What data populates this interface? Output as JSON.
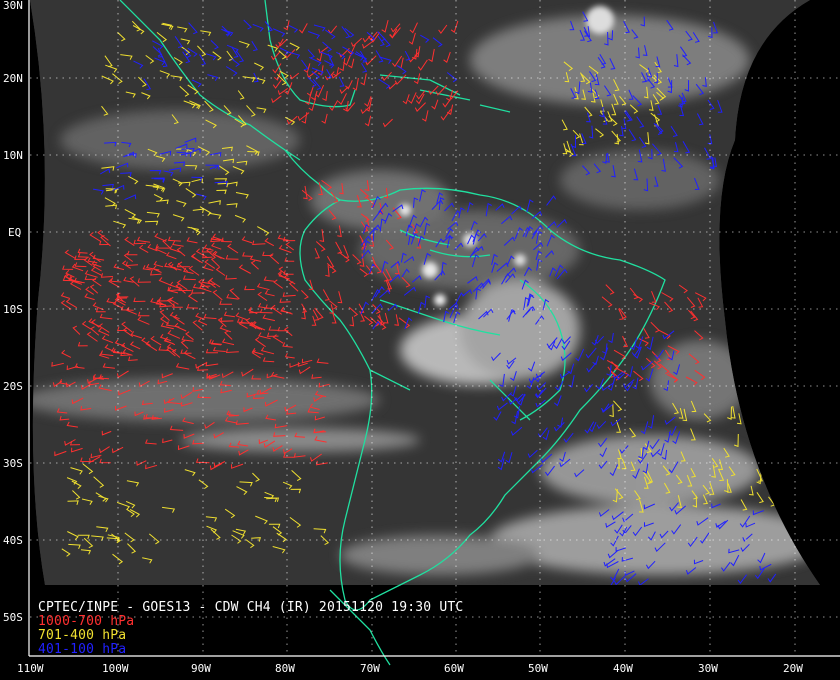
{
  "caption": {
    "title": "CPTEC/INPE - GOES13 - CDW CH4 (IR) 20151120 19:30 UTC",
    "legend": [
      {
        "label": "1000-700 hPa",
        "color": "#ff3030"
      },
      {
        "label": "701-400 hPa",
        "color": "#f0e030"
      },
      {
        "label": "401-100 hPa",
        "color": "#2020ff"
      }
    ]
  },
  "lat_labels": [
    "30N",
    "20N",
    "10N",
    "EQ",
    "10S",
    "20S",
    "30S",
    "40S",
    "50S"
  ],
  "lon_labels": [
    "110W",
    "100W",
    "90W",
    "80W",
    "70W",
    "60W",
    "50W",
    "40W",
    "30W",
    "20W"
  ],
  "colors": {
    "background": "#000000",
    "coastline": "#20e0a0",
    "grid": "#ffffff",
    "low_level_vectors": "#ff3030",
    "mid_level_vectors": "#f0e030",
    "high_level_vectors": "#2020ff"
  }
}
